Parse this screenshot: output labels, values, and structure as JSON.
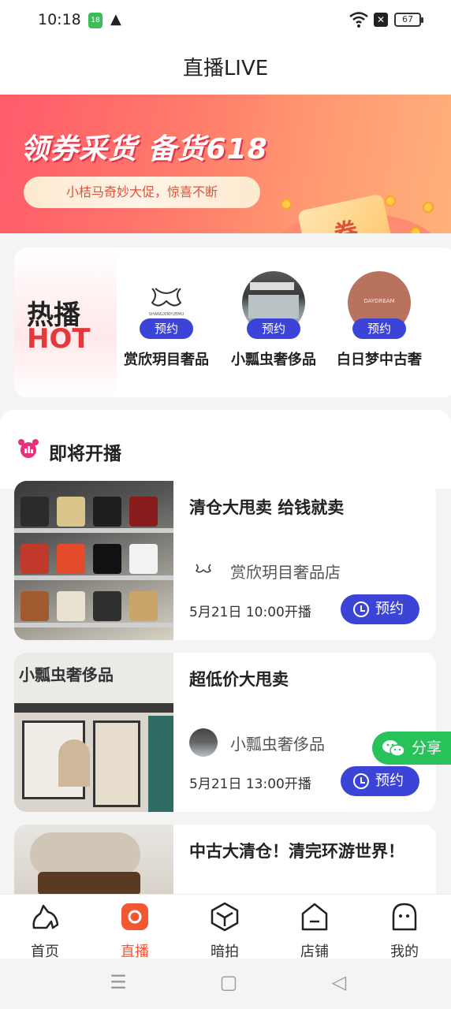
{
  "status": {
    "time": "10:18",
    "battery": "67",
    "calendar_day": "18"
  },
  "header": {
    "title": "直播LIVE"
  },
  "banner": {
    "headline": "领券采货 备货618",
    "subline": "小桔马奇妙大促，惊喜不断",
    "coupon_char": "券"
  },
  "hot": {
    "tag_line1": "热播",
    "tag_line2": "HOT",
    "shops": [
      {
        "name": "赏欣玥目奢品",
        "button": "预约",
        "logo_text": "SHANGXINYUEMU"
      },
      {
        "name": "小瓢虫奢侈品",
        "button": "预约"
      },
      {
        "name": "白日梦中古奢",
        "button": "预约",
        "logo_text": "DAYDREAM"
      }
    ]
  },
  "upcoming": {
    "title": "即将开播",
    "cards": [
      {
        "title": "清仓大甩卖 给钱就卖",
        "shop": "赏欣玥目奢品店",
        "time": "5月21日 10:00开播",
        "button": "预约"
      },
      {
        "title": "超低价大甩卖",
        "shop": "小瓢虫奢侈品",
        "time": "5月21日 13:00开播",
        "button": "预约",
        "store_sign": "小瓢虫奢侈品"
      },
      {
        "title": "中古大清仓！清完环游世界！"
      }
    ]
  },
  "share": {
    "label": "分享"
  },
  "tabs": [
    {
      "label": "首页",
      "icon": "horse-icon"
    },
    {
      "label": "直播",
      "icon": "live-icon",
      "active": true
    },
    {
      "label": "暗拍",
      "icon": "box-icon"
    },
    {
      "label": "店铺",
      "icon": "shop-icon"
    },
    {
      "label": "我的",
      "icon": "profile-icon"
    }
  ],
  "colors": {
    "accent": "#3b44d6",
    "active_tab": "#f25734",
    "share": "#28c25a",
    "hot_red": "#e5383b"
  }
}
